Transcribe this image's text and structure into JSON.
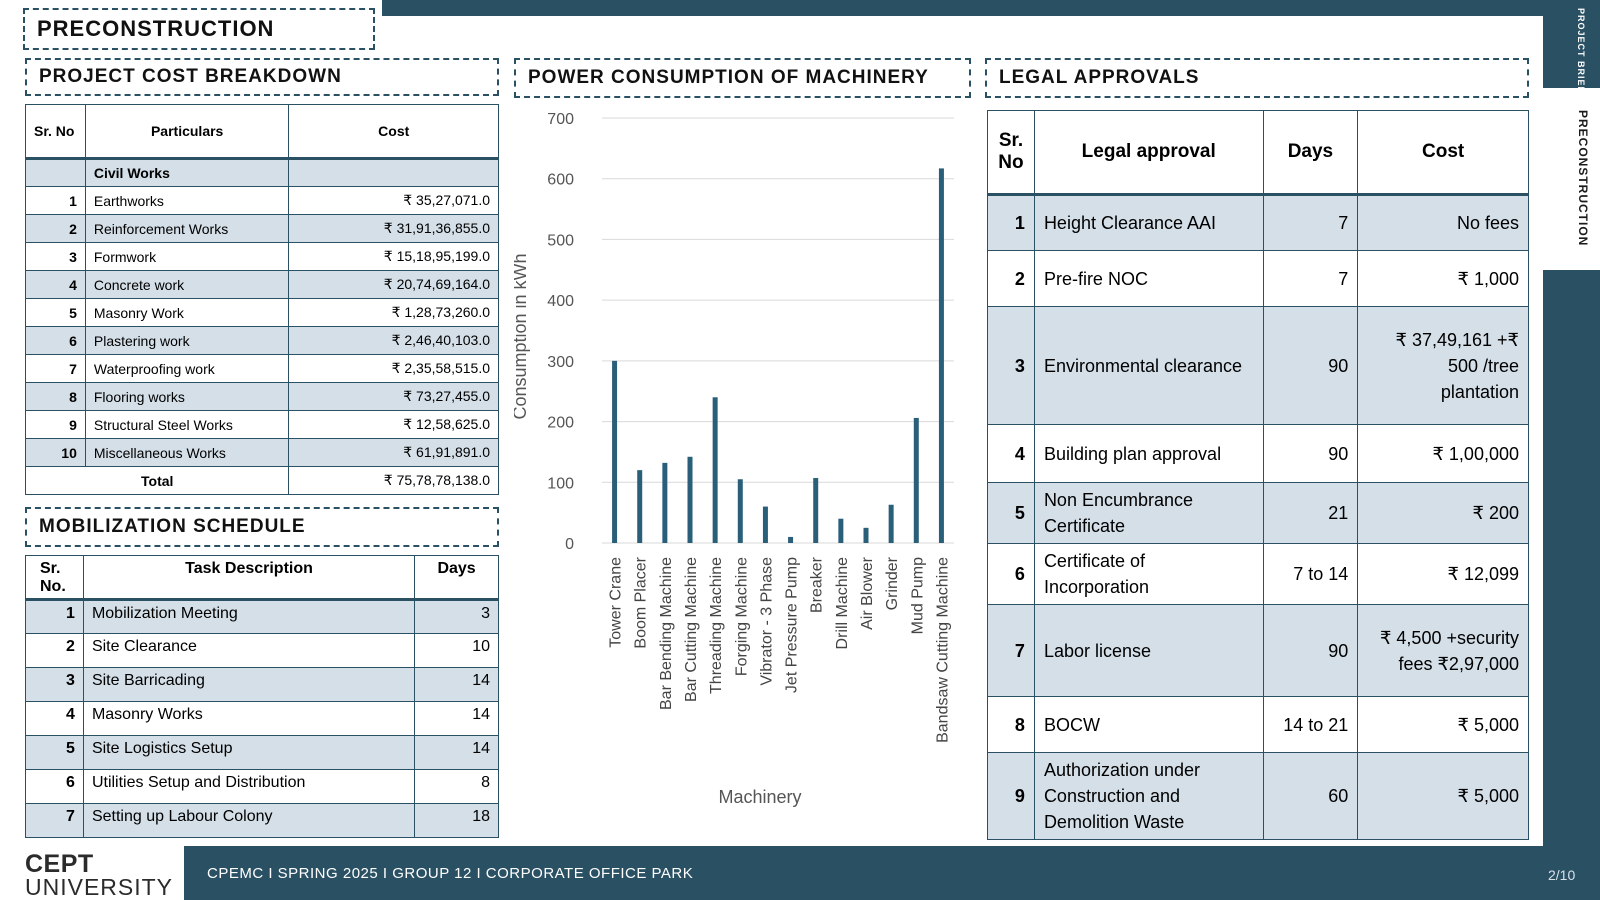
{
  "page_title": "PRECONSTRUCTION",
  "sidebar": {
    "project_brief": "PROJECT BRIEF",
    "section": "PRECONSTRUCTION"
  },
  "footer": {
    "logo_top": "CEPT",
    "logo_bottom": "UNIVERSITY",
    "text": "CPEMC I SPRING 2025 I GROUP 12 I CORPORATE  OFFICE  PARK",
    "page": "2/10"
  },
  "cost": {
    "title": "PROJECT COST BREAKDOWN",
    "headers": [
      "Sr. No",
      "Particulars",
      "Cost"
    ],
    "group": "Civil Works",
    "rows": [
      {
        "no": "1",
        "item": "Earthworks",
        "cost": "₹ 35,27,071.0"
      },
      {
        "no": "2",
        "item": "Reinforcement Works",
        "cost": "₹ 31,91,36,855.0"
      },
      {
        "no": "3",
        "item": "Formwork",
        "cost": "₹ 15,18,95,199.0"
      },
      {
        "no": "4",
        "item": "Concrete work",
        "cost": "₹ 20,74,69,164.0"
      },
      {
        "no": "5",
        "item": "Masonry Work",
        "cost": "₹ 1,28,73,260.0"
      },
      {
        "no": "6",
        "item": "Plastering work",
        "cost": "₹ 2,46,40,103.0"
      },
      {
        "no": "7",
        "item": "Waterproofing  work",
        "cost": "₹ 2,35,58,515.0"
      },
      {
        "no": "8",
        "item": "Flooring works",
        "cost": "₹ 73,27,455.0"
      },
      {
        "no": "9",
        "item": "Structural Steel Works",
        "cost": "₹ 12,58,625.0"
      },
      {
        "no": "10",
        "item": "Miscellaneous  Works",
        "cost": "₹ 61,91,891.0"
      }
    ],
    "total_label": "Total",
    "total": "₹ 75,78,78,138.0"
  },
  "mobilization": {
    "title": "MOBILIZATION SCHEDULE",
    "headers": [
      "Sr. No.",
      "Task Description",
      "Days"
    ],
    "rows": [
      {
        "no": "1",
        "task": "Mobilization Meeting",
        "days": "3"
      },
      {
        "no": "2",
        "task": "Site Clearance",
        "days": "10"
      },
      {
        "no": "3",
        "task": "Site Barricading",
        "days": "14"
      },
      {
        "no": "4",
        "task": "Masonry Works",
        "days": "14"
      },
      {
        "no": "5",
        "task": "Site Logistics Setup",
        "days": "14"
      },
      {
        "no": "6",
        "task": "Utilities Setup and Distribution",
        "days": "8"
      },
      {
        "no": "7",
        "task": "Setting up Labour Colony",
        "days": "18"
      }
    ]
  },
  "power": {
    "title": "POWER CONSUMPTION OF MACHINERY"
  },
  "chart_data": {
    "type": "bar",
    "title": "",
    "xlabel": "Machinery",
    "ylabel": "Consumption in kWh",
    "ylim": [
      0,
      700
    ],
    "yticks": [
      0,
      100,
      200,
      300,
      400,
      500,
      600,
      700
    ],
    "grid": true,
    "bar_color": "#2a5f7a",
    "categories": [
      "Tower Crane",
      "Boom Placer",
      "Bar Bending Machine",
      "Bar Cutting Machine",
      "Threading Machine",
      "Forging Machine",
      "Vibrator - 3 Phase",
      "Jet Pressure Pump",
      "Breaker",
      "Drill Machine",
      "Air Blower",
      "Grinder",
      "Mud Pump",
      "Bandsaw Cutting Machine"
    ],
    "values": [
      300,
      120,
      132,
      142,
      240,
      105,
      60,
      10,
      107,
      40,
      25,
      63,
      206,
      617
    ]
  },
  "legal": {
    "title": "LEGAL APPROVALS",
    "headers": [
      "Sr. No",
      "Legal approval",
      "Days",
      "Cost"
    ],
    "rows": [
      {
        "no": "1",
        "item": "Height Clearance AAI",
        "days": "7",
        "cost": "No fees"
      },
      {
        "no": "2",
        "item": "Pre-fire NOC",
        "days": "7",
        "cost": "₹ 1,000"
      },
      {
        "no": "3",
        "item": "Environmental clearance",
        "days": "90",
        "cost": "₹ 37,49,161 +₹ 500 /tree plantation"
      },
      {
        "no": "4",
        "item": "Building plan approval",
        "days": "90",
        "cost": "₹ 1,00,000"
      },
      {
        "no": "5",
        "item": "Non Encumbrance Certificate",
        "days": "21",
        "cost": "₹ 200"
      },
      {
        "no": "6",
        "item": "Certificate of Incorporation",
        "days": "7 to 14",
        "cost": "₹ 12,099"
      },
      {
        "no": "7",
        "item": "Labor license",
        "days": "90",
        "cost": "₹ 4,500 +security fees ₹2,97,000"
      },
      {
        "no": "8",
        "item": "BOCW",
        "days": "14 to 21",
        "cost": "₹ 5,000"
      },
      {
        "no": "9",
        "item": "Authorization under Construction and Demolition Waste",
        "days": "60",
        "cost": "₹ 5,000"
      }
    ]
  }
}
